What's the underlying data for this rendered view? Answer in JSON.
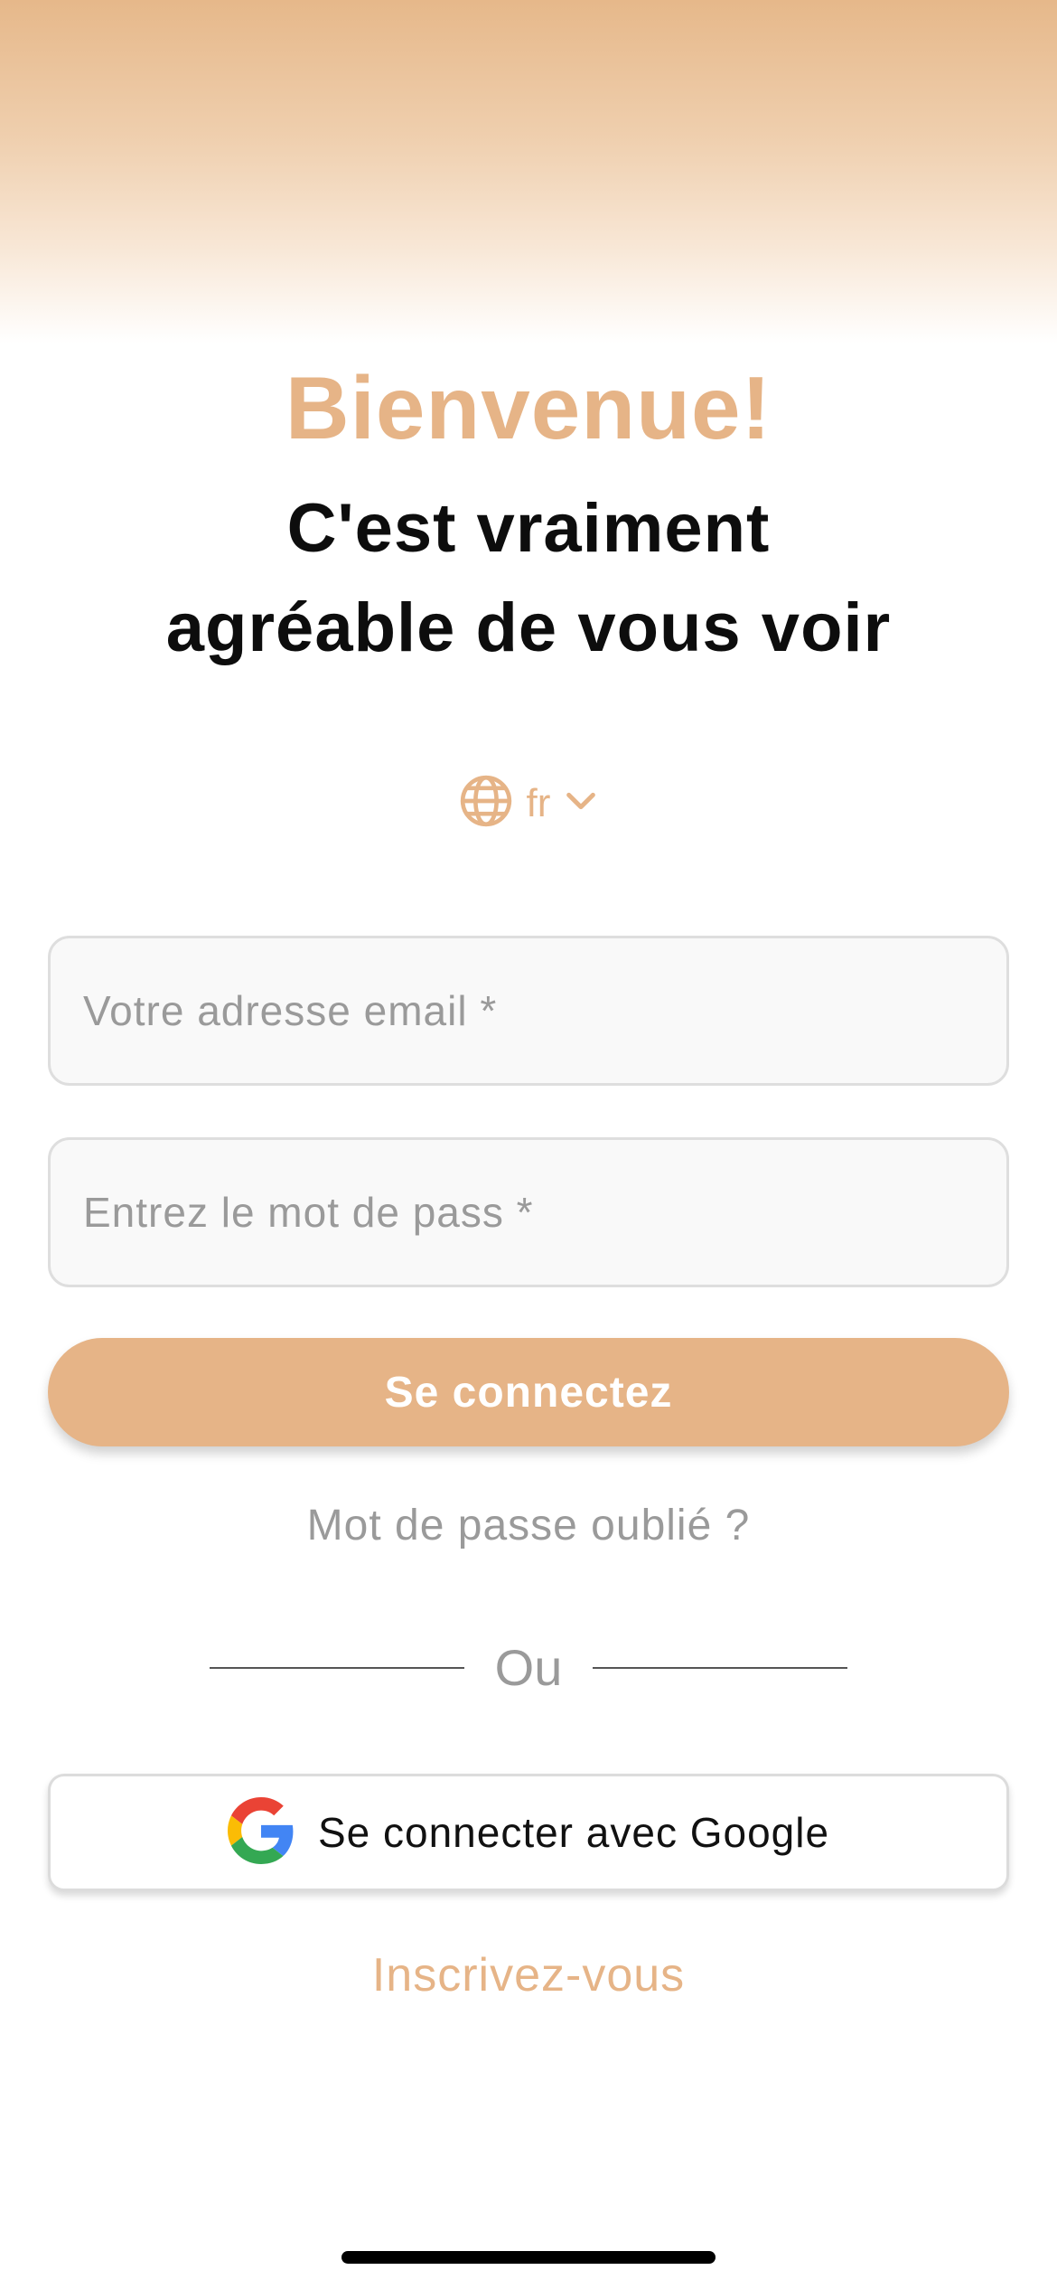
{
  "colors": {
    "accent": "#e6b487",
    "gradient_top": "#e6b88a",
    "placeholder_text": "#9a9a9a",
    "heading_text": "#0d0d0d"
  },
  "header": {
    "title": "Bienvenue!",
    "subtitle_line1": "C'est vraiment",
    "subtitle_line2": "agréable de vous voir"
  },
  "language_selector": {
    "icon": "globe-icon",
    "value": "fr",
    "chevron_icon": "chevron-down-icon"
  },
  "form": {
    "email": {
      "value": "",
      "placeholder": "Votre adresse email *"
    },
    "password": {
      "value": "",
      "placeholder": "Entrez le mot de pass *"
    },
    "login_button_label": "Se connectez",
    "forgot_password_link": "Mot de passe oublié ?"
  },
  "divider": {
    "label": "Ou"
  },
  "google_button": {
    "icon": "google-logo-icon",
    "label": "Se connecter avec Google"
  },
  "signup_link": "Inscrivez-vous"
}
